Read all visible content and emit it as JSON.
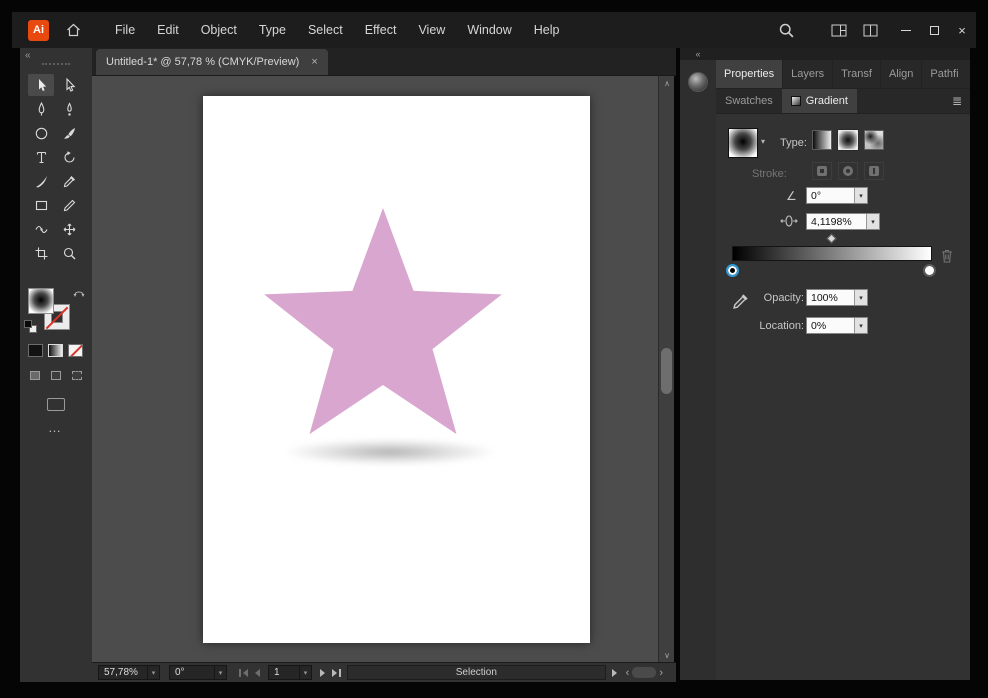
{
  "titlebar": {
    "logo": "Ai",
    "menus": [
      "File",
      "Edit",
      "Object",
      "Type",
      "Select",
      "Effect",
      "View",
      "Window",
      "Help"
    ]
  },
  "tab": {
    "title": "Untitled-1* @ 57,78 % (CMYK/Preview)"
  },
  "toolbar": {
    "tools": [
      "selection",
      "direct-selection",
      "pen",
      "curvature",
      "ellipse",
      "paintbrush",
      "type",
      "rotate",
      "knife",
      "eyedropper",
      "rectangle",
      "pencil",
      "width",
      "free-transform",
      "artboard",
      "zoom"
    ]
  },
  "panel": {
    "tabs": [
      "Properties",
      "Layers",
      "Transf",
      "Align",
      "Pathfi"
    ],
    "subtabs": [
      "Swatches",
      "Gradient"
    ],
    "gradient": {
      "type_label": "Type:",
      "stroke_label": "Stroke:",
      "angle_value": "0°",
      "aspect_value": "4,1198%",
      "opacity_label": "Opacity:",
      "opacity_value": "100%",
      "location_label": "Location:",
      "location_value": "0%"
    }
  },
  "statusbar": {
    "zoom": "57,78%",
    "rotation": "0°",
    "artboard_number": "1",
    "status": "Selection"
  },
  "canvas": {
    "star_fill": "#d9a6cf"
  },
  "glyphs": {
    "close": "×",
    "chevron": "▾",
    "collapse": "«",
    "scroll_up": "∧",
    "scroll_down": "∨",
    "scroll_left": "‹",
    "scroll_right": "›",
    "panel_menu": "≣",
    "angle": "∠",
    "ellipsis": "…"
  }
}
